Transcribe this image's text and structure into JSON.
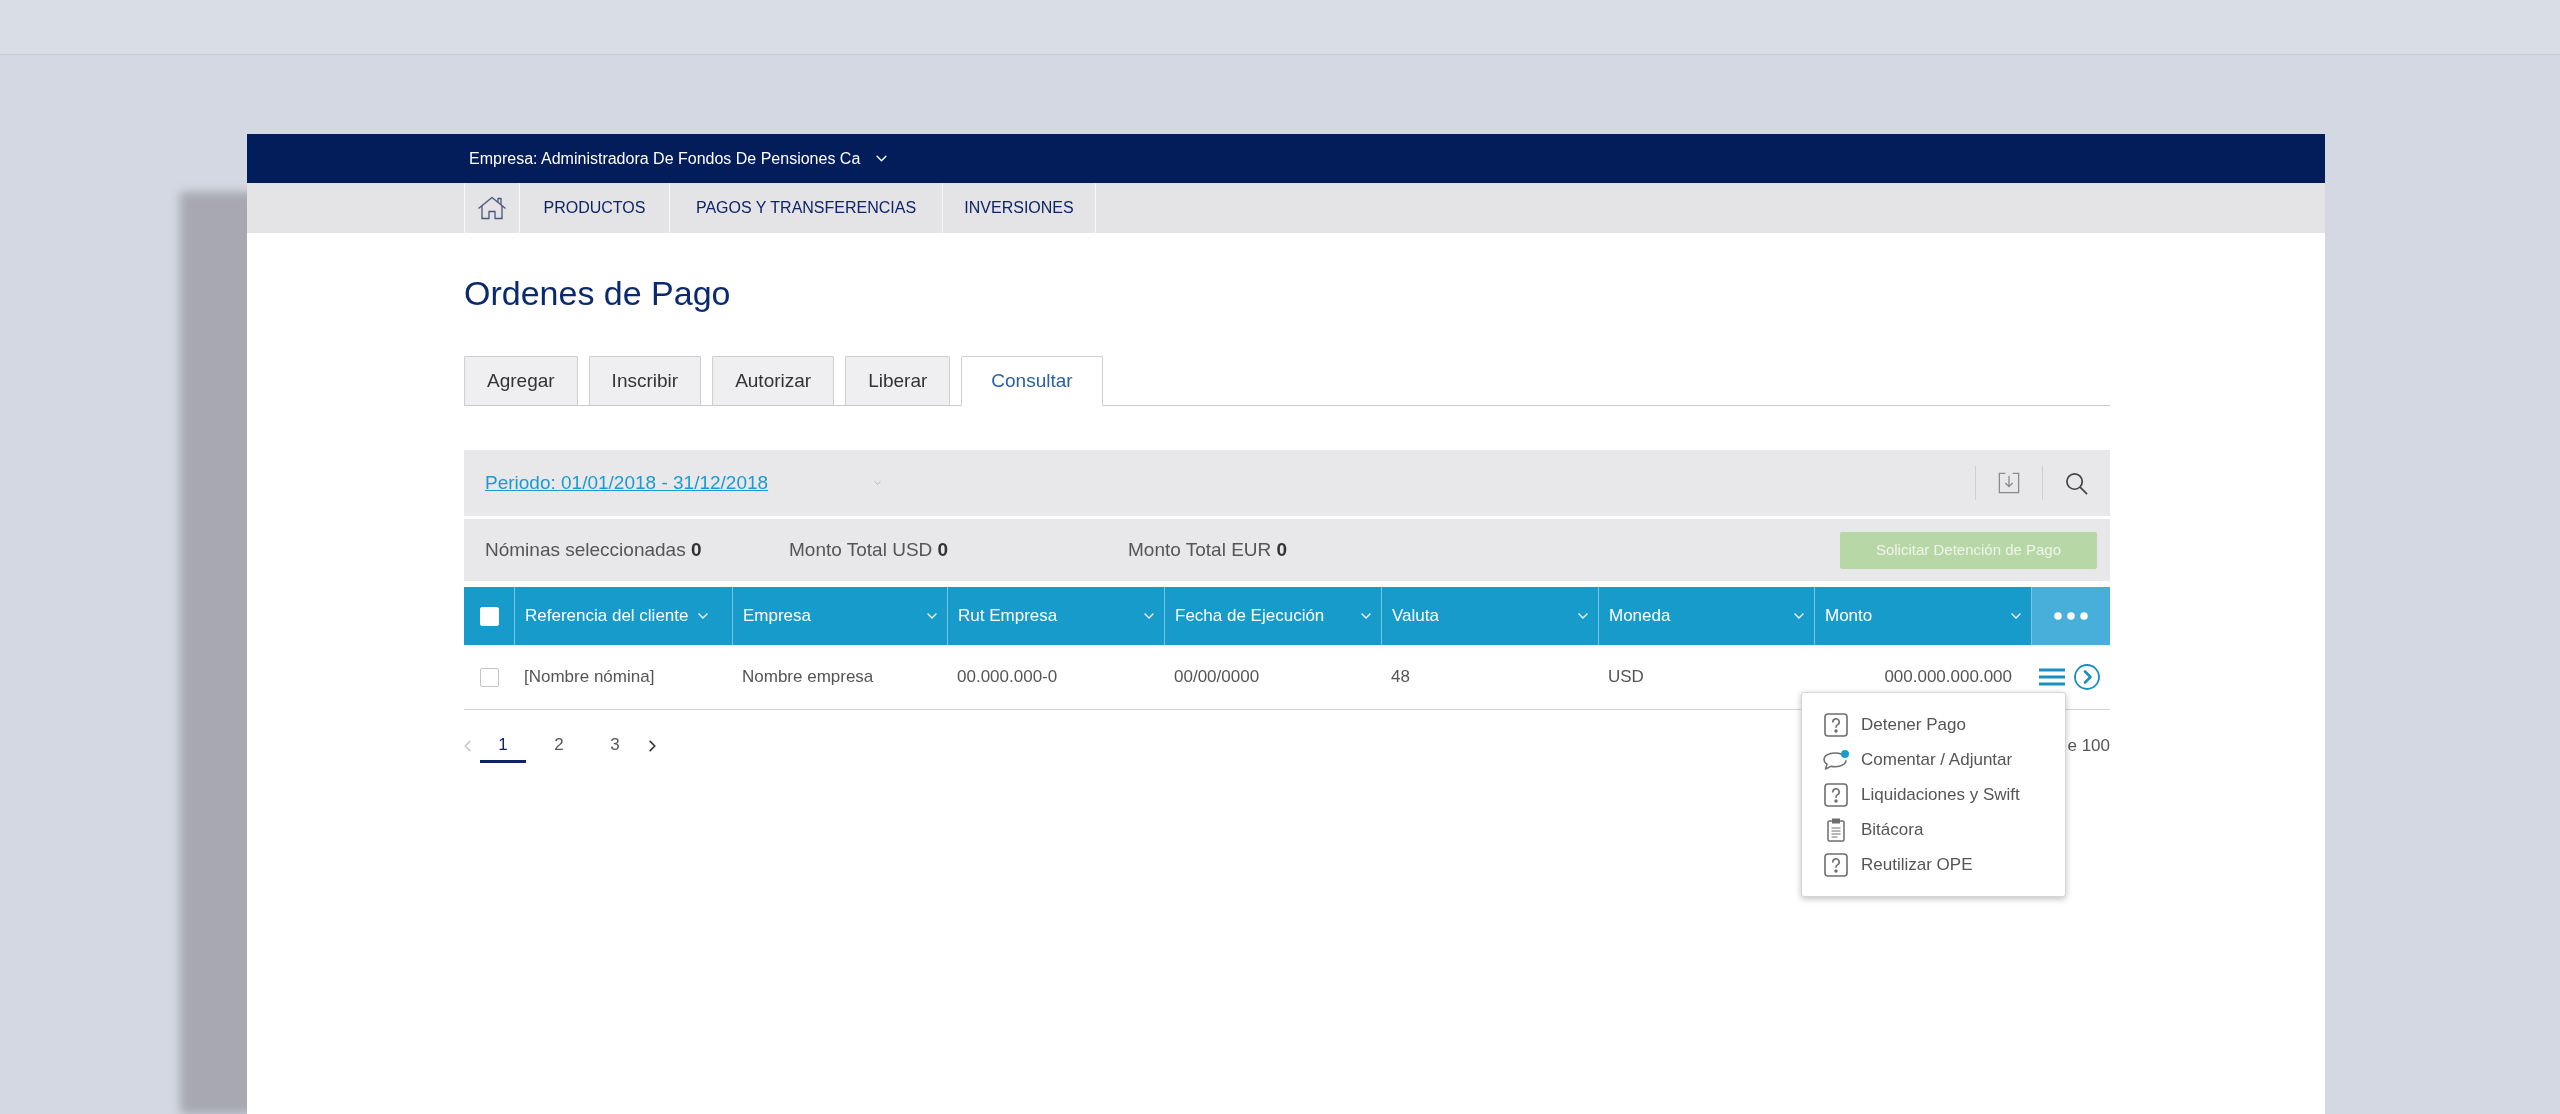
{
  "company_bar": {
    "label": "Empresa: Administradora De Fondos De Pensiones Ca"
  },
  "nav": {
    "items": [
      {
        "label": "PRODUCTOS"
      },
      {
        "label": "PAGOS Y TRANSFERENCIAS"
      },
      {
        "label": "INVERSIONES"
      }
    ]
  },
  "page_title": "Ordenes de Pago",
  "tabs": [
    {
      "label": "Agregar",
      "selected": false
    },
    {
      "label": "Inscribir",
      "selected": false
    },
    {
      "label": "Autorizar",
      "selected": false
    },
    {
      "label": "Liberar",
      "selected": false
    },
    {
      "label": "Consultar",
      "selected": true
    }
  ],
  "filter_bar": {
    "period": "Periodo: 01/01/2018 - 31/12/2018"
  },
  "summary": {
    "items": [
      {
        "label": "Nóminas seleccionadas",
        "value": "0"
      },
      {
        "label": "Monto Total USD",
        "value": "0"
      },
      {
        "label": "Monto Total EUR",
        "value": "0"
      }
    ],
    "action": {
      "label": "Solicitar Detención de Pago",
      "disabled": true
    }
  },
  "table": {
    "select_all": {
      "checked": false
    },
    "columns": [
      {
        "label": "Referencia del cliente"
      },
      {
        "label": "Empresa"
      },
      {
        "label": "Rut Empresa"
      },
      {
        "label": "Fecha de Ejecución"
      },
      {
        "label": "Valuta"
      },
      {
        "label": "Moneda"
      },
      {
        "label": "Monto"
      }
    ],
    "rows": [
      {
        "checked": false,
        "cells": [
          "[Nombre nómina]",
          "Nombre empresa",
          "00.000.000-0",
          "00/00/0000",
          "48",
          "USD",
          "000.000.000.000"
        ]
      }
    ]
  },
  "pagination": {
    "prev": {
      "disabled": true
    },
    "pages": [
      {
        "label": "1",
        "selected": true
      },
      {
        "label": "2",
        "selected": false
      },
      {
        "label": "3",
        "selected": false
      }
    ],
    "next": {
      "disabled": false
    },
    "range": "e 100"
  },
  "row_menu": {
    "items": [
      {
        "kind": "help",
        "label": "Detener Pago"
      },
      {
        "kind": "comment",
        "label": "Comentar / Adjuntar"
      },
      {
        "kind": "help",
        "label": "Liquidaciones y Swift"
      },
      {
        "kind": "log",
        "label": "Bitácora"
      },
      {
        "kind": "help",
        "label": "Reutilizar OPE"
      }
    ]
  }
}
